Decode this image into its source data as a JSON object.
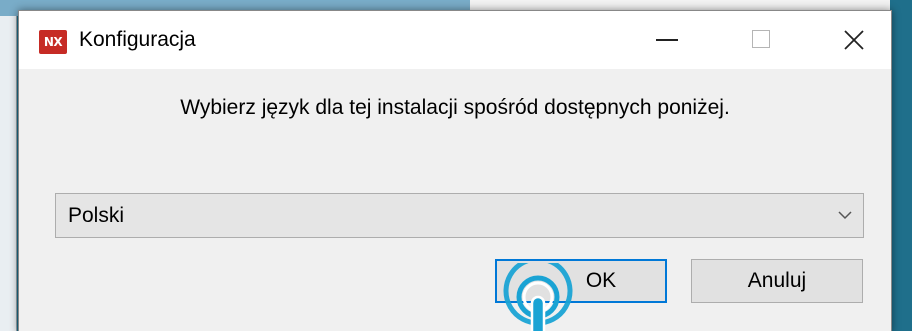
{
  "dialog": {
    "title": "Konfiguracja",
    "app_icon_text": "NX",
    "message": "Wybierz język dla tej instalacji spośród dostępnych poniżej.",
    "language_select": {
      "value": "Polski"
    },
    "ok_label": "OK",
    "cancel_label": "Anuluj"
  },
  "colors": {
    "app_icon": "#c62b25",
    "focus_border": "#0078d7",
    "touch_indicator": "#1aa3d4"
  }
}
